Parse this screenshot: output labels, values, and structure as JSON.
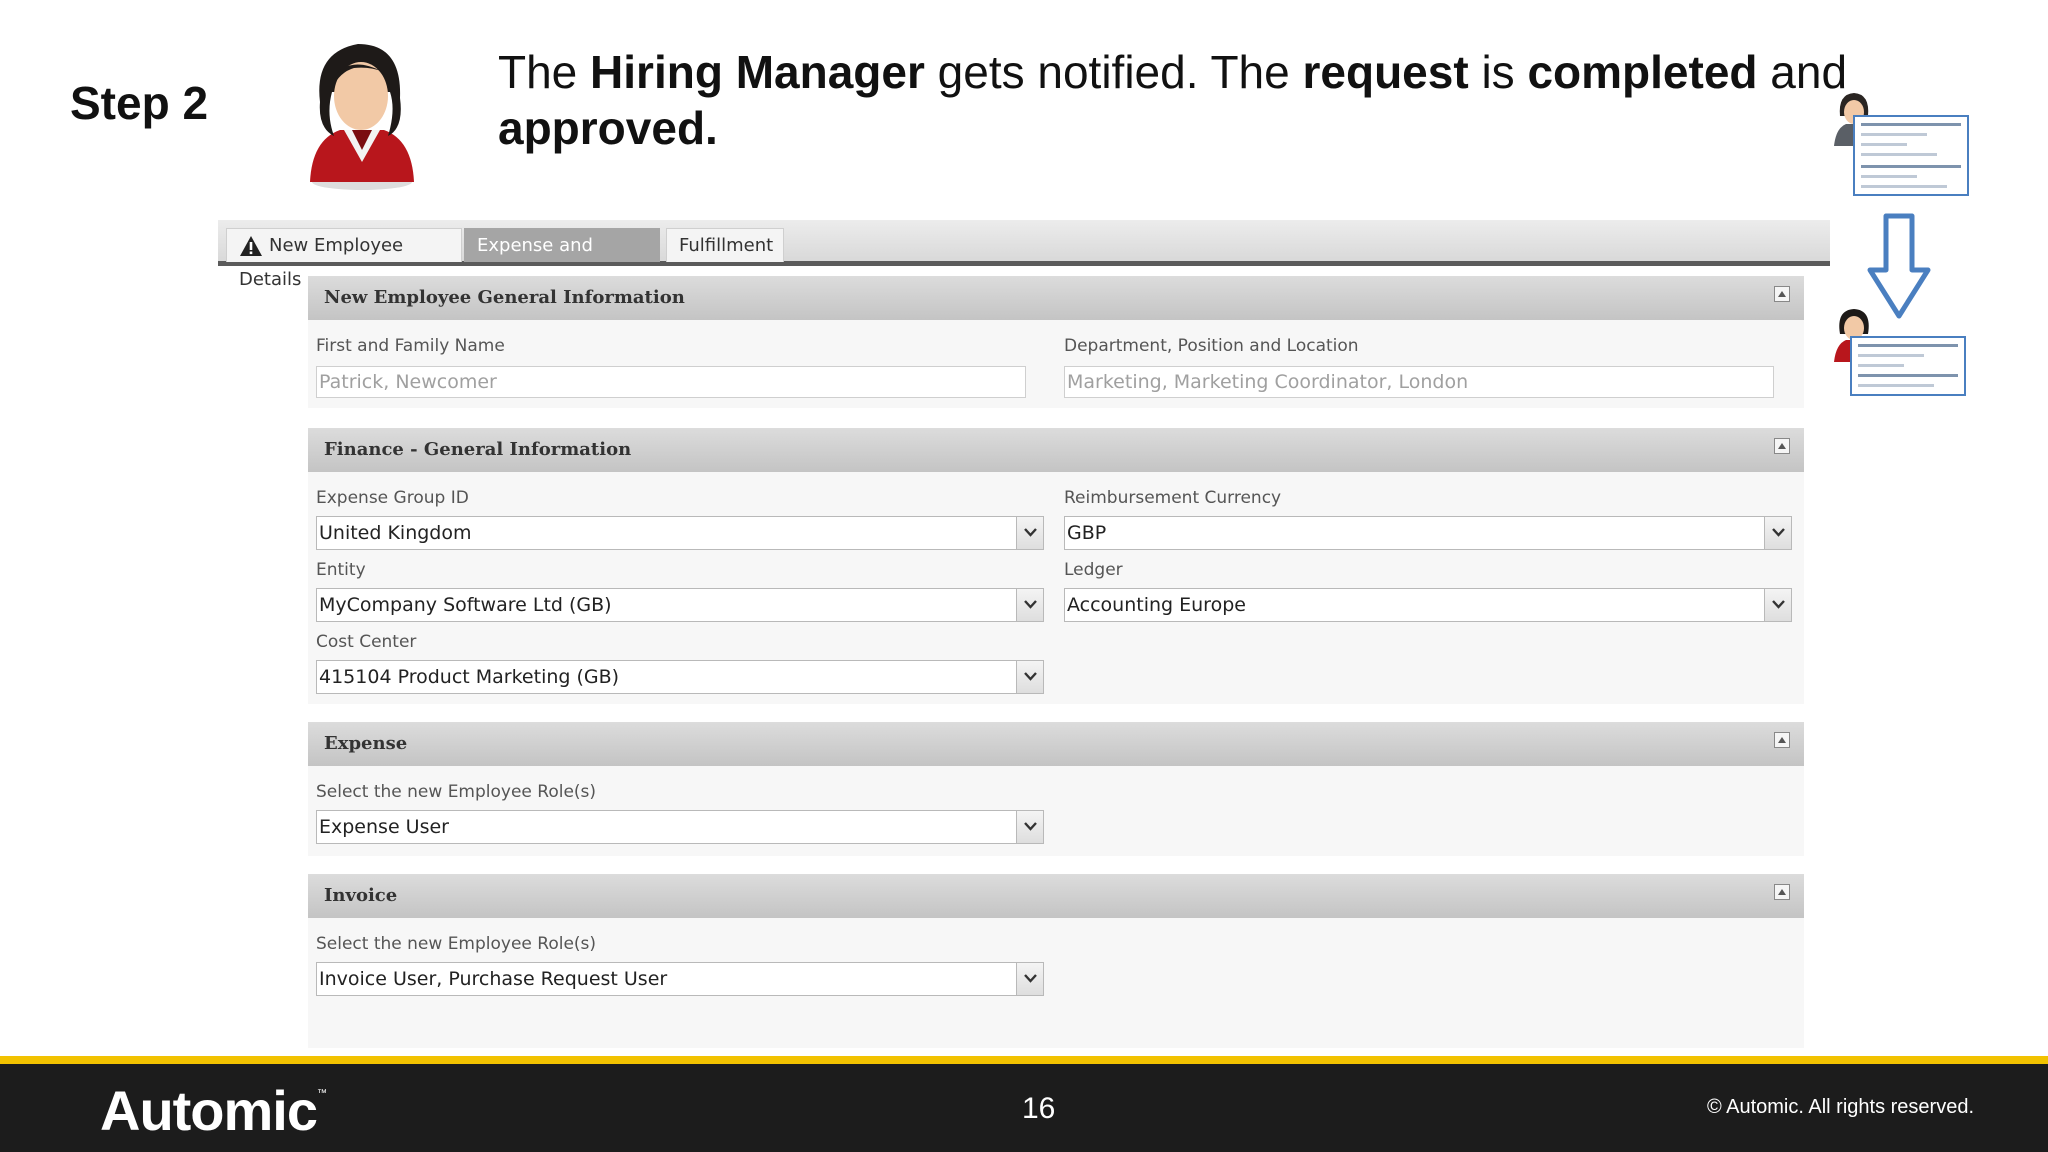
{
  "slide": {
    "step": "Step 2",
    "headline": {
      "t1": "The ",
      "b1": "Hiring Manager",
      "t2": " gets notified. The ",
      "b2": "request",
      "t3": " is ",
      "b3": "completed",
      "t4": " and ",
      "b4": "approved."
    }
  },
  "tabs": [
    {
      "label": "New Employee Details",
      "icon": "warning-icon",
      "active": false
    },
    {
      "label": "Expense and Invoice",
      "active": true
    },
    {
      "label": "Fulfillment",
      "active": false
    }
  ],
  "sections": {
    "general": {
      "title": "New Employee General Information",
      "name_label": "First and Family Name",
      "name_value": "Patrick, Newcomer",
      "dept_label": "Department, Position and Location",
      "dept_value": "Marketing, Marketing Coordinator, London"
    },
    "finance": {
      "title": "Finance - General Information",
      "expense_group_label": "Expense Group ID",
      "expense_group_value": "United Kingdom",
      "currency_label": "Reimbursement Currency",
      "currency_value": "GBP",
      "entity_label": "Entity",
      "entity_value": "MyCompany Software Ltd (GB)",
      "ledger_label": "Ledger",
      "ledger_value": "Accounting Europe",
      "cost_center_label": "Cost Center",
      "cost_center_value": "415104 Product Marketing (GB)"
    },
    "expense": {
      "title": "Expense",
      "roles_label": "Select the new Employee Role(s)",
      "roles_value": "Expense User"
    },
    "invoice": {
      "title": "Invoice",
      "roles_label": "Select the new Employee Role(s)",
      "roles_value": "Invoice User, Purchase Request User"
    }
  },
  "footer": {
    "logo": "Automic",
    "trademark": "™",
    "page_number": "16",
    "copyright": "© Automic. All rights reserved."
  },
  "colors": {
    "accent_yellow": "#f2c200",
    "footer_bg": "#1c1c1c",
    "flow_blue": "#4a7fc0",
    "active_tab": "#a5a5a5"
  }
}
